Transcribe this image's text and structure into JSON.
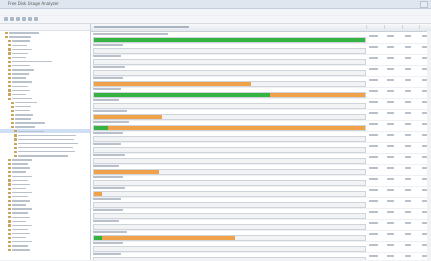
{
  "window": {
    "title": "Free Disk Usage Analyzer"
  },
  "menu": [
    "File",
    "View",
    "Help"
  ],
  "colors": {
    "green": "#35b342",
    "orange": "#f0a24a"
  },
  "rows": [
    {
      "green": 1.0,
      "orange": 0
    },
    {
      "green": 0,
      "orange": 0
    },
    {
      "green": 0,
      "orange": 0
    },
    {
      "green": 0,
      "orange": 0
    },
    {
      "green": 0,
      "orange": 0.58
    },
    {
      "green": 0.65,
      "orange": 1.0
    },
    {
      "green": 0,
      "orange": 0
    },
    {
      "green": 0,
      "orange": 0.25
    },
    {
      "green": 0.05,
      "orange": 1.0
    },
    {
      "green": 0,
      "orange": 0
    },
    {
      "green": 0,
      "orange": 0
    },
    {
      "green": 0,
      "orange": 0
    },
    {
      "green": 0,
      "orange": 0.24
    },
    {
      "green": 0,
      "orange": 0
    },
    {
      "green": 0,
      "orange": 0.03
    },
    {
      "green": 0,
      "orange": 0
    },
    {
      "green": 0,
      "orange": 0
    },
    {
      "green": 0,
      "orange": 0
    },
    {
      "green": 0.03,
      "orange": 0.52
    },
    {
      "green": 0,
      "orange": 0
    },
    {
      "green": 0,
      "orange": 0
    }
  ]
}
